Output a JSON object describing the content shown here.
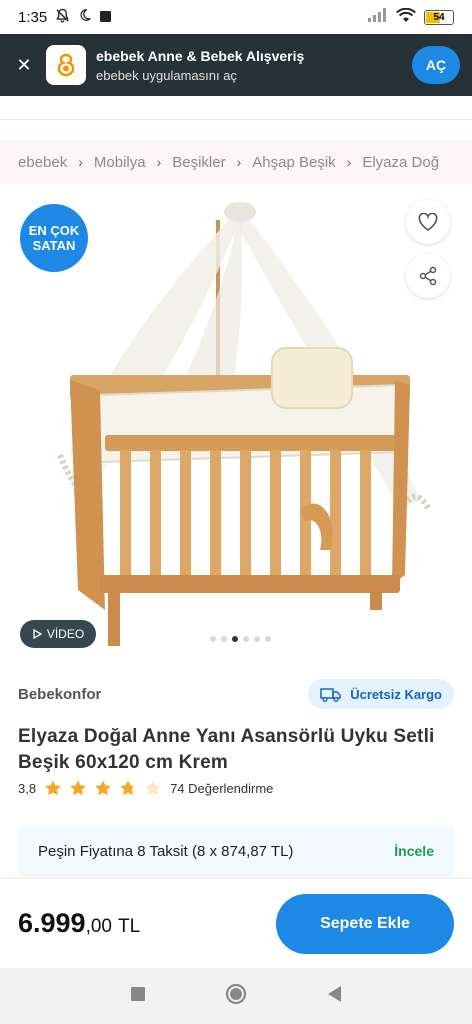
{
  "status_bar": {
    "time": "1:35",
    "battery_level": "54",
    "battery_color": "#f2c200"
  },
  "app_banner": {
    "title": "ebebek Anne & Bebek Alışveriş",
    "subtitle": "ebebek uygulamasını aç",
    "open_label": "AÇ",
    "close_icon": "close-icon",
    "accent": "#1e88e5"
  },
  "breadcrumb": {
    "items": [
      "ebebek",
      "Mobilya",
      "Beşikler",
      "Ahşap Beşik",
      "Elyaza Doğ"
    ]
  },
  "gallery": {
    "badge_line1": "EN ÇOK",
    "badge_line2": "SATAN",
    "video_label": "VİDEO",
    "dot_count": 6,
    "active_dot": 3
  },
  "product": {
    "brand": "Bebekonfor",
    "cargo_label": "Ücretsiz Kargo",
    "title": "Elyaza Doğal Anne Yanı Asansörlü Uyku Setli Beşik 60x120 cm Krem",
    "rating": "3,8",
    "rating_count_label": "74 Değerlendirme",
    "stars_value": 3.8
  },
  "installment": {
    "text": "Peşin Fiyatına 8 Taksit (8 x 874,87 TL)",
    "link": "İncele",
    "link_color": "#1b9e4b"
  },
  "purchase": {
    "price_integer": "6.999",
    "price_decimal": ",00",
    "currency": "TL",
    "add_to_cart": "Sepete Ekle",
    "button_color": "#1e88e5"
  }
}
